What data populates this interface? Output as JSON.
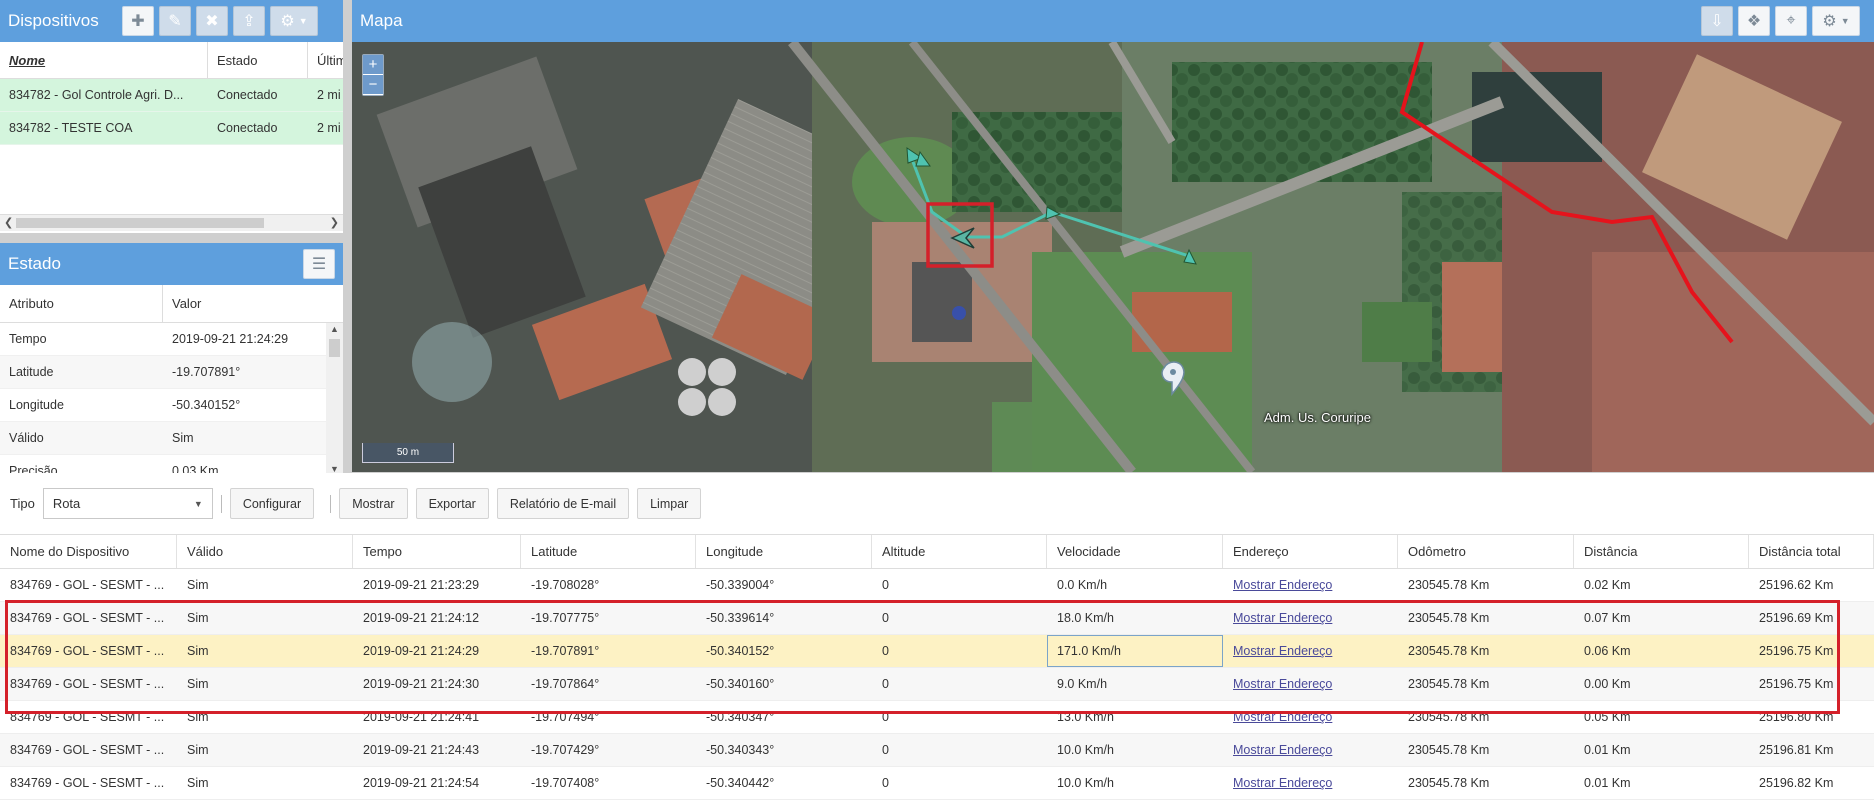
{
  "devices_panel": {
    "title": "Dispositivos",
    "columns": [
      "Nome",
      "Estado",
      "Últim"
    ],
    "rows": [
      {
        "name": "834782 - Gol Controle Agri. D...",
        "status": "Conectado",
        "last": "2 mi"
      },
      {
        "name": "834782 - TESTE COA",
        "status": "Conectado",
        "last": "2 mi"
      }
    ]
  },
  "state_panel": {
    "title": "Estado",
    "columns": [
      "Atributo",
      "Valor"
    ],
    "rows": [
      {
        "attr": "Tempo",
        "value": "2019-09-21 21:24:29"
      },
      {
        "attr": "Latitude",
        "value": "-19.707891°"
      },
      {
        "attr": "Longitude",
        "value": "-50.340152°"
      },
      {
        "attr": "Válido",
        "value": "Sim"
      },
      {
        "attr": "Precisão",
        "value": "0.03 Km"
      }
    ]
  },
  "map": {
    "title": "Mapa",
    "zoom_in": "+",
    "zoom_out": "−",
    "scale": "50 m",
    "poi_label": "Adm. Us. Coruripe"
  },
  "report": {
    "type_label": "Tipo",
    "type_value": "Rota",
    "buttons": [
      "Configurar",
      "Mostrar",
      "Exportar",
      "Relatório de E-mail",
      "Limpar"
    ],
    "columns": [
      "Nome do Dispositivo",
      "Válido",
      "Tempo",
      "Latitude",
      "Longitude",
      "Altitude",
      "Velocidade",
      "Endereço",
      "Odômetro",
      "Distância",
      "Distância total"
    ],
    "rows": [
      [
        "834769 - GOL - SESMT - ...",
        "Sim",
        "2019-09-21 21:23:29",
        "-19.708028°",
        "-50.339004°",
        "0",
        "0.0 Km/h",
        "Mostrar Endereço",
        "230545.78 Km",
        "0.02 Km",
        "25196.62 Km"
      ],
      [
        "834769 - GOL - SESMT - ...",
        "Sim",
        "2019-09-21 21:24:12",
        "-19.707775°",
        "-50.339614°",
        "0",
        "18.0 Km/h",
        "Mostrar Endereço",
        "230545.78 Km",
        "0.07 Km",
        "25196.69 Km"
      ],
      [
        "834769 - GOL - SESMT - ...",
        "Sim",
        "2019-09-21 21:24:29",
        "-19.707891°",
        "-50.340152°",
        "0",
        "171.0 Km/h",
        "Mostrar Endereço",
        "230545.78 Km",
        "0.06 Km",
        "25196.75 Km"
      ],
      [
        "834769 - GOL - SESMT - ...",
        "Sim",
        "2019-09-21 21:24:30",
        "-19.707864°",
        "-50.340160°",
        "0",
        "9.0 Km/h",
        "Mostrar Endereço",
        "230545.78 Km",
        "0.00 Km",
        "25196.75 Km"
      ],
      [
        "834769 - GOL - SESMT - ...",
        "Sim",
        "2019-09-21 21:24:41",
        "-19.707494°",
        "-50.340347°",
        "0",
        "13.0 Km/h",
        "Mostrar Endereço",
        "230545.78 Km",
        "0.05 Km",
        "25196.80 Km"
      ],
      [
        "834769 - GOL - SESMT - ...",
        "Sim",
        "2019-09-21 21:24:43",
        "-19.707429°",
        "-50.340343°",
        "0",
        "10.0 Km/h",
        "Mostrar Endereço",
        "230545.78 Km",
        "0.01 Km",
        "25196.81 Km"
      ],
      [
        "834769 - GOL - SESMT - ...",
        "Sim",
        "2019-09-21 21:24:54",
        "-19.707408°",
        "-50.340442°",
        "0",
        "10.0 Km/h",
        "Mostrar Endereço",
        "230545.78 Km",
        "0.01 Km",
        "25196.82 Km"
      ]
    ]
  },
  "colors": {
    "header": "#5e9fdd",
    "device_row": "#d4f5dd",
    "selected_row": "#fdf2c4",
    "highlight": "#d4202a",
    "route": "#4fc3b0"
  }
}
